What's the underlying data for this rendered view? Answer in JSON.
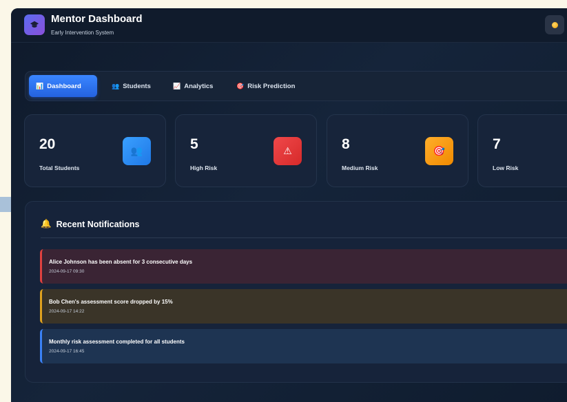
{
  "header": {
    "title": "Mentor Dashboard",
    "subtitle": "Early Intervention System",
    "logo_icon": "graduation-cap-icon",
    "theme_icon": "sun-icon"
  },
  "nav": {
    "tabs": [
      {
        "label": "Dashboard",
        "icon": "📊",
        "active": true
      },
      {
        "label": "Students",
        "icon": "👥",
        "active": false
      },
      {
        "label": "Analytics",
        "icon": "📈",
        "active": false
      },
      {
        "label": "Risk Prediction",
        "icon": "🎯",
        "active": false
      }
    ]
  },
  "stats": [
    {
      "value": "20",
      "label": "Total Students",
      "icon": "👥",
      "color": "#2b8cf5"
    },
    {
      "value": "5",
      "label": "High Risk",
      "icon": "⚠",
      "color": "#e53935"
    },
    {
      "value": "8",
      "label": "Medium Risk",
      "icon": "🎯",
      "color": "#f59e0b"
    },
    {
      "value": "7",
      "label": "Low Risk"
    }
  ],
  "notifications": {
    "title": "Recent Notifications",
    "icon": "🔔",
    "items": [
      {
        "message": "Alice Johnson has been absent for 3 consecutive days",
        "time": "2024-09-17 09:30",
        "severity": "high"
      },
      {
        "message": "Bob Chen's assessment score dropped by 15%",
        "time": "2024-09-17 14:22",
        "severity": "medium"
      },
      {
        "message": "Monthly risk assessment completed for all students",
        "time": "2024-09-17 16:45",
        "severity": "info"
      }
    ]
  }
}
